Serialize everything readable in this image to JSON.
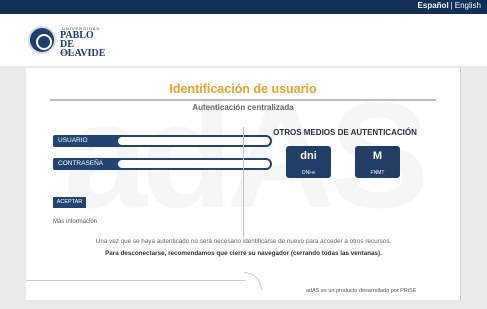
{
  "topbar": {
    "lang_es": "Español",
    "lang_sep": "|",
    "lang_en": "English"
  },
  "logo": {
    "top_text": "UNIVERSIDAD",
    "main_text": "PABLO DE OLAVIDE",
    "bottom_text": "SEVILLA"
  },
  "watermark": "adAS",
  "page": {
    "title": "Identificación de usuario",
    "subtitle": "Autenticación centralizada"
  },
  "login": {
    "user_label": "USUARIO",
    "user_value": "",
    "pass_label": "CONTRASEÑA",
    "pass_value": "",
    "accept_label": "ACEPTAR",
    "more_info": "Más información"
  },
  "other_methods": {
    "title": "OTROS MEDIOS DE AUTENTICACIÓN",
    "dni_glyph": "dni",
    "dni_caption": "DNI-e",
    "fnmt_glyph": "M",
    "fnmt_caption": "FNMT"
  },
  "notices": {
    "line1": "Una vez que se haya autenticado no será necesario identificarse de nuevo para acceder a otros recursos.",
    "line2": "Para desconectarse, recomendamos que cierre su navegador (cerrando todas las ventanas)."
  },
  "footer": {
    "text": "adAS es un producto desarrollado por PRiSE"
  },
  "colors": {
    "topbar": "#0f3158",
    "accent": "#f0a21c",
    "field": "#1f4577"
  }
}
